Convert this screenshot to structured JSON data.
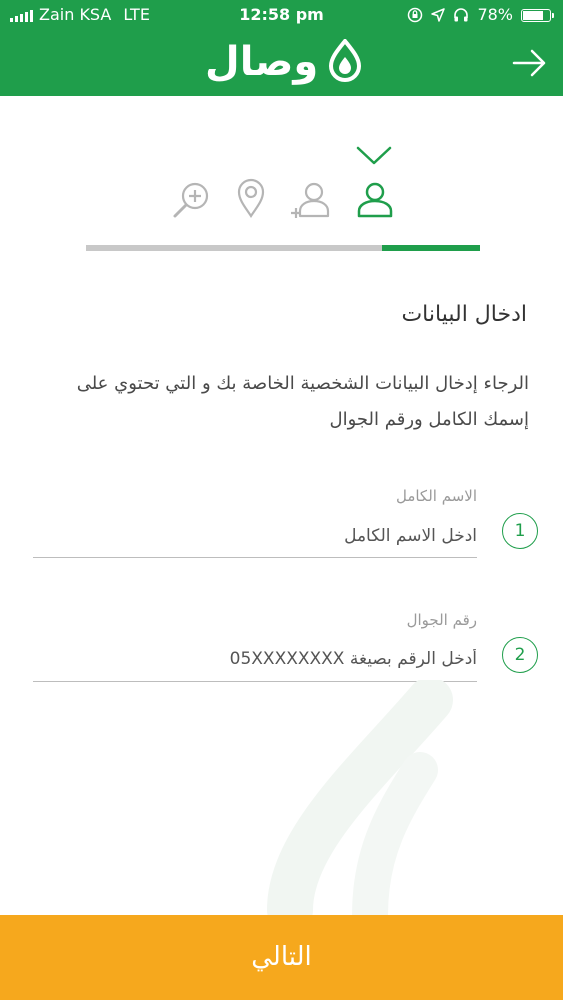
{
  "status_bar": {
    "carrier": "Zain KSA",
    "network": "LTE",
    "time": "12:58 pm",
    "battery_text": "78%",
    "battery_level": 0.78,
    "icons": [
      "signal-icon",
      "rotation-lock-icon",
      "location-arrow-icon",
      "headphones-icon",
      "battery-icon"
    ]
  },
  "header": {
    "app_name": "وصال",
    "bg_color": "#1f9e4b",
    "back_icon": "arrow-right-icon"
  },
  "steps": {
    "icons": [
      "user-icon",
      "add-user-icon",
      "location-pin-icon",
      "search-plus-icon"
    ],
    "active_index": 0,
    "active_color": "#1f9e4b",
    "inactive_color": "#b5b5b5",
    "progress": 0.25
  },
  "content": {
    "title": "ادخال البيانات",
    "description": "الرجاء إدخال البيانات الشخصية الخاصة بك و التي تحتوي على إسمك الكامل ورقم الجوال"
  },
  "form": {
    "fields": [
      {
        "number": "1",
        "label": "الاسم الكامل",
        "placeholder": "ادخل الاسم الكامل",
        "value": ""
      },
      {
        "number": "2",
        "label": "رقم الجوال",
        "placeholder": "أدخل الرقم بصيغة 05XXXXXXXX",
        "value": ""
      }
    ]
  },
  "footer": {
    "next_label": "التالي",
    "button_color": "#f6a81d"
  }
}
